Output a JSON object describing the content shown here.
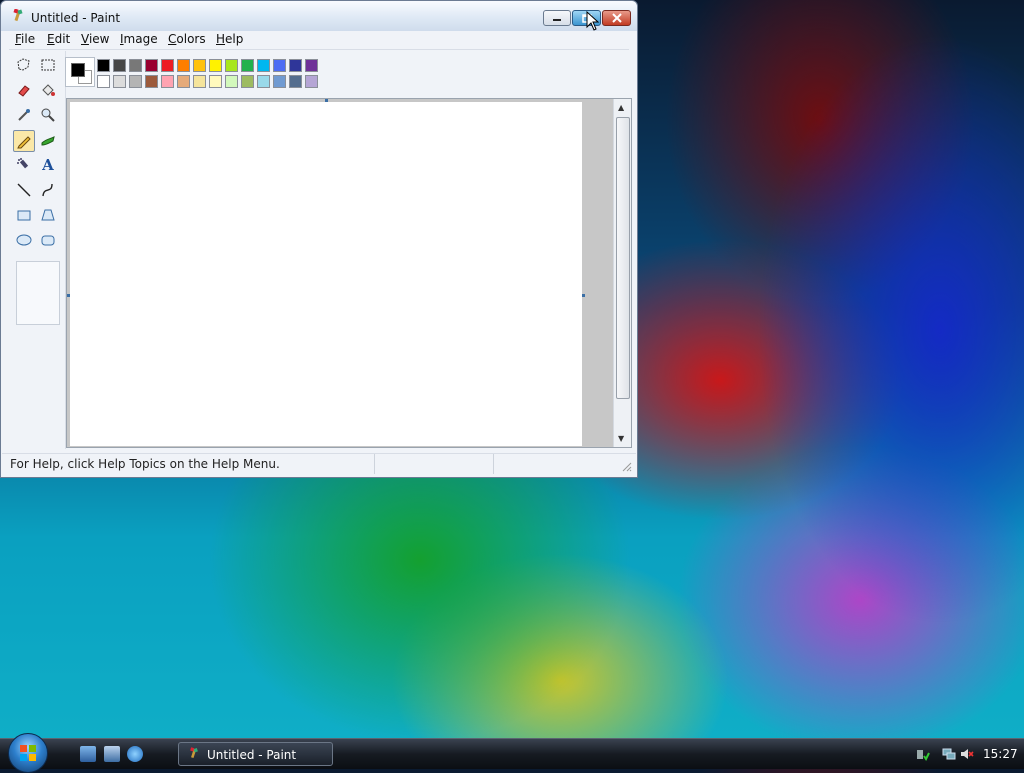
{
  "window": {
    "title": "Untitled - Paint",
    "buttons": {
      "minimize": "minimize",
      "maximize": "maximize",
      "close": "close"
    }
  },
  "menu": [
    {
      "label": "File",
      "accel": "F",
      "rest": "ile"
    },
    {
      "label": "Edit",
      "accel": "E",
      "rest": "dit"
    },
    {
      "label": "View",
      "accel": "V",
      "rest": "iew"
    },
    {
      "label": "Image",
      "accel": "I",
      "rest": "mage"
    },
    {
      "label": "Colors",
      "accel": "C",
      "rest": "olors"
    },
    {
      "label": "Help",
      "accel": "H",
      "rest": "elp"
    }
  ],
  "tools": [
    {
      "name": "free-form-select-icon",
      "selected": false
    },
    {
      "name": "rect-select-icon",
      "selected": false
    },
    {
      "name": "eraser-icon",
      "selected": false
    },
    {
      "name": "fill-bucket-icon",
      "selected": false
    },
    {
      "name": "color-picker-icon",
      "selected": false
    },
    {
      "name": "magnifier-icon",
      "selected": false
    },
    {
      "name": "pencil-icon",
      "selected": true
    },
    {
      "name": "brush-icon",
      "selected": false
    },
    {
      "name": "airbrush-icon",
      "selected": false
    },
    {
      "name": "text-icon",
      "selected": false
    },
    {
      "name": "line-icon",
      "selected": false
    },
    {
      "name": "curve-icon",
      "selected": false
    },
    {
      "name": "rectangle-icon",
      "selected": false
    },
    {
      "name": "polygon-icon",
      "selected": false
    },
    {
      "name": "ellipse-icon",
      "selected": false
    },
    {
      "name": "rounded-rect-icon",
      "selected": false
    }
  ],
  "text_tool_letter": "A",
  "palette": {
    "foreground": "#000000",
    "background": "#ffffff",
    "row1": [
      "#000000",
      "#464646",
      "#787878",
      "#990030",
      "#ed1c24",
      "#ff7e00",
      "#ffc20e",
      "#fff200",
      "#a8e61d",
      "#22b14c",
      "#00b7ef",
      "#4d6df3",
      "#2f3699",
      "#6f3198"
    ],
    "row2": [
      "#ffffff",
      "#dcdcdc",
      "#b4b4b4",
      "#9c5a3c",
      "#ffa3b1",
      "#e5aa7a",
      "#f5e49c",
      "#fff9bd",
      "#d3f9bc",
      "#9dbb61",
      "#99d9ea",
      "#709ad1",
      "#546d8e",
      "#b5a5d5"
    ]
  },
  "status": {
    "help_text": "For Help, click Help Topics on the Help Menu."
  },
  "taskbar": {
    "task_label": "Untitled - Paint",
    "clock": "15:27"
  }
}
